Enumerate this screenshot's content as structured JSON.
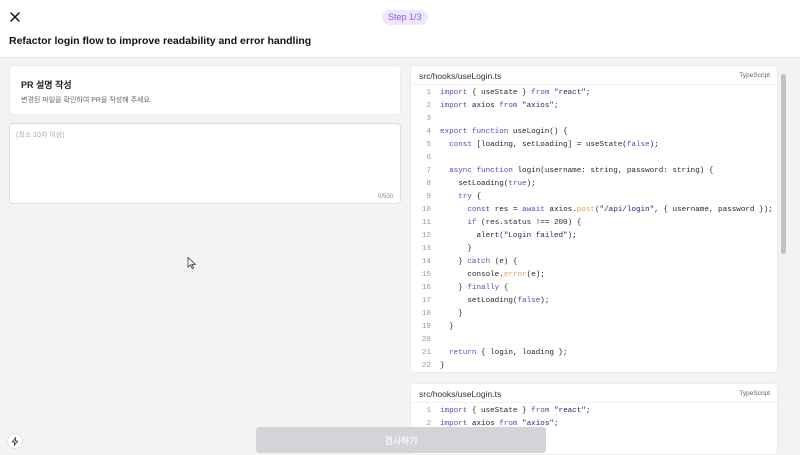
{
  "header": {
    "step_label": "Step 1/3",
    "title": "Refactor login flow to improve readability and error handling"
  },
  "description_card": {
    "title": "PR 설명 작성",
    "subtitle": "변경된 파일을 확인하여 PR을 작성해 주세요."
  },
  "textarea": {
    "placeholder": "(최소 10자 이상)",
    "char_count": "0/500"
  },
  "code_files": [
    {
      "file_name": "src/hooks/useLogin.ts",
      "language": "TypeScript",
      "lines": [
        {
          "n": "1",
          "html": "<span class='k'>import</span> { useState } <span class='k'>from</span> <span class='s'>\"react\"</span>;"
        },
        {
          "n": "2",
          "html": "<span class='k'>import</span> axios <span class='k'>from</span> <span class='s'>\"axios\"</span>;"
        },
        {
          "n": "3",
          "html": ""
        },
        {
          "n": "4",
          "html": "<span class='k'>export function</span> useLogin() {"
        },
        {
          "n": "5",
          "html": "  <span class='k'>const</span> [loading, setLoading] = useState(<span class='bool'>false</span>);"
        },
        {
          "n": "6",
          "html": ""
        },
        {
          "n": "7",
          "html": "  <span class='k'>async function</span> login(username: string, password: string) {"
        },
        {
          "n": "8",
          "html": "    setLoading(<span class='bool'>true</span>);"
        },
        {
          "n": "9",
          "html": "    <span class='k'>try</span> {"
        },
        {
          "n": "10",
          "html": "      <span class='k'>const</span> res = <span class='k'>await</span> axios.<span class='fn'>post</span>(<span class='s'>\"/api/login\"</span>, { username, password });"
        },
        {
          "n": "11",
          "html": "      <span class='k'>if</span> (res.status !== 200) {"
        },
        {
          "n": "12",
          "html": "        alert(<span class='s'>\"Login failed\"</span>);"
        },
        {
          "n": "13",
          "html": "      }"
        },
        {
          "n": "14",
          "html": "    } <span class='k'>catch</span> (e) {"
        },
        {
          "n": "15",
          "html": "      console.<span class='fn'>error</span>(e);"
        },
        {
          "n": "16",
          "html": "    } <span class='k'>finally</span> {"
        },
        {
          "n": "17",
          "html": "      setLoading(<span class='bool'>false</span>);"
        },
        {
          "n": "18",
          "html": "    }"
        },
        {
          "n": "19",
          "html": "  }"
        },
        {
          "n": "20",
          "html": ""
        },
        {
          "n": "21",
          "html": "  <span class='k'>return</span> { login, loading };"
        },
        {
          "n": "22",
          "html": "}"
        }
      ]
    },
    {
      "file_name": "src/hooks/useLogin.ts",
      "language": "TypeScript",
      "lines": [
        {
          "n": "1",
          "html": "<span class='k'>import</span> { useState } <span class='k'>from</span> <span class='s'>\"react\"</span>;"
        },
        {
          "n": "2",
          "html": "<span class='k'>import</span> axios <span class='k'>from</span> <span class='s'>\"axios\"</span>;"
        }
      ]
    }
  ],
  "footer": {
    "submit_label": "검사하기"
  },
  "icons": {
    "close": "close-icon",
    "bolt": "bolt-icon",
    "cursor": "mouse-cursor-icon"
  },
  "colors": {
    "accent": "#8a5cf6",
    "keyword": "#5b48c7",
    "function": "#e4a24b",
    "button_disabled": "#d4d4d8"
  }
}
